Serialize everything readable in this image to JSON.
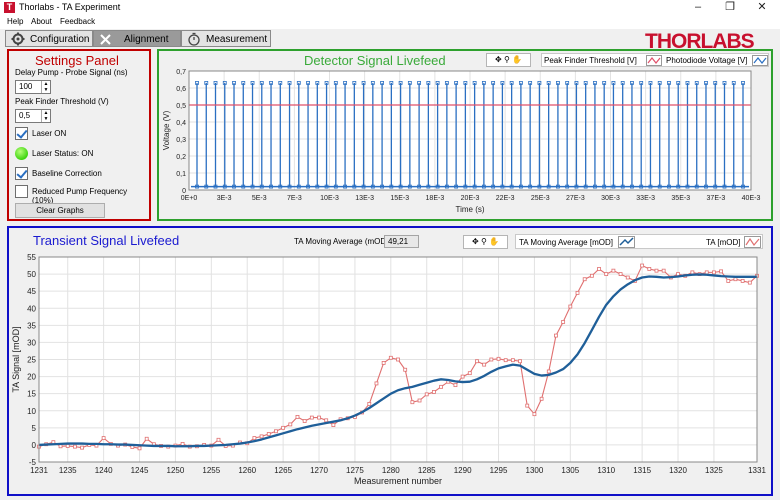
{
  "window": {
    "title": "Thorlabs - TA Experiment",
    "icon_letter": "T",
    "controls": [
      "–",
      "❐",
      "✕"
    ]
  },
  "menu": [
    "Help",
    "About",
    "Feedback"
  ],
  "tabs": [
    {
      "label": "Configuration",
      "icon": "gear-icon"
    },
    {
      "label": "Alignment",
      "icon": "tools-icon"
    },
    {
      "label": "Measurement",
      "icon": "stopwatch-icon"
    }
  ],
  "logo": "THORLABS",
  "settings": {
    "title": "Settings Panel",
    "delay_label": "Delay Pump - Probe Signal (ns)",
    "delay_value": "100",
    "threshold_label": "Peak Finder Threshold (V)",
    "threshold_value": "0,5",
    "laser_on_label": "Laser ON",
    "laser_on_checked": true,
    "laser_status_label": "Laser Status: ON",
    "baseline_label": "Baseline Correction",
    "baseline_checked": true,
    "reduced_label": "Reduced Pump Frequency (10%)",
    "reduced_checked": false,
    "clear_button": "Clear Graphs"
  },
  "detector": {
    "title": "Detector Signal Livefeed",
    "tools": [
      "✥",
      "⚲",
      "✋"
    ],
    "legend": [
      {
        "label": "Peak Finder Threshold [V]",
        "color": "#e0506a"
      },
      {
        "label": "Photodiode Voltage [V]",
        "color": "#2a6fc2"
      }
    ],
    "chart_data": {
      "type": "line",
      "xlabel": "Time (s)",
      "ylabel": "Voltage (V)",
      "ylim": [
        0,
        0.7
      ],
      "yticks": [
        "0",
        "0,1",
        "0,2",
        "0,3",
        "0,4",
        "0,5",
        "0,6",
        "0,7"
      ],
      "xticks": [
        "0E+0",
        "3E-3",
        "5E-3",
        "7E-3",
        "10E-3",
        "13E-3",
        "15E-3",
        "18E-3",
        "20E-3",
        "22E-3",
        "25E-3",
        "27E-3",
        "30E-3",
        "33E-3",
        "35E-3",
        "37E-3",
        "40E-3"
      ],
      "threshold": 0.5,
      "pulse_count": 60,
      "pulse_peak": 0.63,
      "baseline": 0.02,
      "grid": true
    }
  },
  "transient": {
    "title": "Transient Signal Livefeed",
    "avg_label": "TA Moving Average (mOD)",
    "avg_value": "49,21",
    "tools": [
      "✥",
      "⚲",
      "✋"
    ],
    "legend": [
      {
        "label": "TA Moving Average [mOD]",
        "color": "#1f5f99"
      },
      {
        "label": "TA [mOD]",
        "color": "#e07070"
      }
    ],
    "chart_data": {
      "type": "line",
      "xlabel": "Measurement number",
      "ylabel": "TA Signal [mOD]",
      "xlim": [
        1231,
        1331
      ],
      "ylim": [
        -5,
        55
      ],
      "xticks": [
        1231,
        1235,
        1240,
        1245,
        1250,
        1255,
        1260,
        1265,
        1270,
        1275,
        1280,
        1285,
        1290,
        1295,
        1300,
        1305,
        1310,
        1315,
        1320,
        1325,
        1331
      ],
      "yticks": [
        -5,
        0,
        5,
        10,
        15,
        20,
        25,
        30,
        35,
        40,
        45,
        50,
        55
      ],
      "grid": true,
      "series": [
        {
          "name": "TA [mOD]",
          "x_start": 1231,
          "values": [
            -0.5,
            0.2,
            0.8,
            -0.4,
            -0.3,
            -0.5,
            -0.8,
            0.0,
            -0.2,
            2.0,
            0.3,
            -0.2,
            0.1,
            -0.6,
            -1.0,
            1.8,
            0.2,
            -0.3,
            -0.5,
            -0.2,
            0.3,
            -0.5,
            -0.4,
            0.0,
            -0.2,
            1.5,
            -0.3,
            -0.2,
            0.7,
            0.5,
            2.0,
            2.5,
            3.2,
            4.0,
            5.0,
            6.0,
            8.2,
            7.0,
            8.0,
            8.0,
            7.2,
            5.8,
            7.5,
            7.8,
            8.2,
            9.5,
            12.0,
            18.0,
            24.0,
            25.5,
            25.0,
            22.0,
            12.5,
            13.0,
            14.8,
            15.5,
            17.0,
            18.5,
            17.5,
            20.0,
            21.0,
            24.5,
            23.5,
            25.0,
            25.2,
            24.8,
            24.8,
            24.5,
            11.5,
            9.0,
            13.5,
            21.5,
            32.0,
            36.0,
            40.5,
            44.5,
            48.5,
            49.5,
            51.5,
            50.0,
            51.0,
            50.0,
            49.0,
            48.0,
            52.5,
            51.5,
            51.0,
            51.0,
            49.0,
            50.0,
            49.5,
            50.5,
            50.0,
            50.5,
            50.5,
            50.8,
            48.0,
            48.5,
            48.0,
            47.5,
            49.5
          ]
        },
        {
          "name": "TA Moving Average [mOD]",
          "x_start": 1231,
          "values": [
            0.0,
            0.1,
            0.2,
            0.3,
            0.4,
            0.4,
            0.4,
            0.3,
            0.3,
            0.2,
            0.2,
            0.1,
            0.1,
            0.0,
            -0.1,
            -0.2,
            -0.3,
            -0.3,
            -0.3,
            -0.4,
            -0.4,
            -0.4,
            -0.3,
            -0.3,
            -0.2,
            -0.1,
            0.0,
            0.2,
            0.4,
            0.7,
            1.1,
            1.6,
            2.2,
            2.8,
            3.4,
            4.0,
            4.6,
            5.1,
            5.6,
            6.0,
            6.4,
            6.8,
            7.2,
            7.8,
            8.6,
            9.6,
            10.8,
            12.2,
            13.6,
            15.0,
            16.0,
            16.6,
            17.0,
            17.6,
            18.2,
            18.8,
            19.2,
            19.0,
            18.6,
            18.4,
            18.5,
            19.2,
            20.2,
            21.4,
            22.4,
            23.0,
            23.5,
            23.2,
            22.0,
            20.8,
            20.3,
            20.5,
            21.2,
            22.2,
            24.0,
            26.5,
            29.8,
            33.6,
            37.5,
            41.0,
            43.5,
            45.5,
            47.0,
            48.2,
            49.0,
            49.3,
            49.2,
            49.0,
            49.1,
            49.3,
            49.6,
            49.8,
            49.9,
            49.8,
            49.6,
            49.4,
            49.3,
            49.2,
            49.2,
            49.2,
            49.2
          ]
        }
      ]
    }
  }
}
